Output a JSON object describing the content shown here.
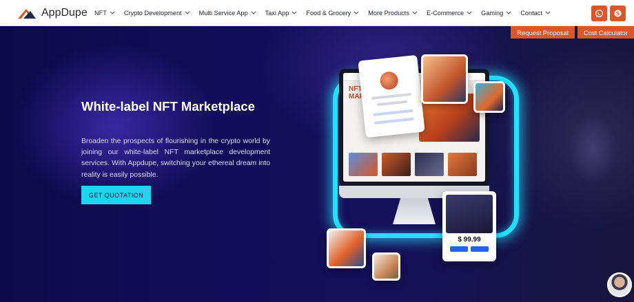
{
  "brand": {
    "name": "AppDupe",
    "accent": "#d9572b"
  },
  "nav": {
    "items": [
      {
        "label": "NFT",
        "icon": "chevron-down-icon"
      },
      {
        "label": "Crypto Development",
        "icon": "chevron-down-icon"
      },
      {
        "label": "Multi Service App",
        "icon": "chevron-down-icon"
      },
      {
        "label": "Taxi App",
        "icon": "chevron-down-icon"
      },
      {
        "label": "Food & Grocery",
        "icon": "chevron-down-icon"
      },
      {
        "label": "More Products",
        "icon": "chevron-down-icon"
      },
      {
        "label": "E-Commerce",
        "icon": "chevron-down-icon"
      },
      {
        "label": "Gaming",
        "icon": "chevron-down-icon"
      },
      {
        "label": "Contact",
        "icon": "chevron-down-icon"
      }
    ],
    "actions": [
      {
        "icon": "whatsapp-icon"
      },
      {
        "icon": "skype-icon"
      }
    ]
  },
  "cta_strip": {
    "request_proposal": "Request Proposal",
    "cost_calculator": "Cost Calculator"
  },
  "hero": {
    "title": "White-label NFT Marketplace",
    "description": "Broaden the prospects of flourishing in the crypto world by joining our white-label NFT marketplace development services. With Appdupe, switching your ethereal dream into reality is easily possible.",
    "button": "GET QUOTATION",
    "button_color": "#22d3ee",
    "illustration": {
      "screen_heading": "NFT MARKETPLACE",
      "price": "$ 99.99"
    }
  },
  "chat": {
    "icon": "chat-avatar"
  }
}
